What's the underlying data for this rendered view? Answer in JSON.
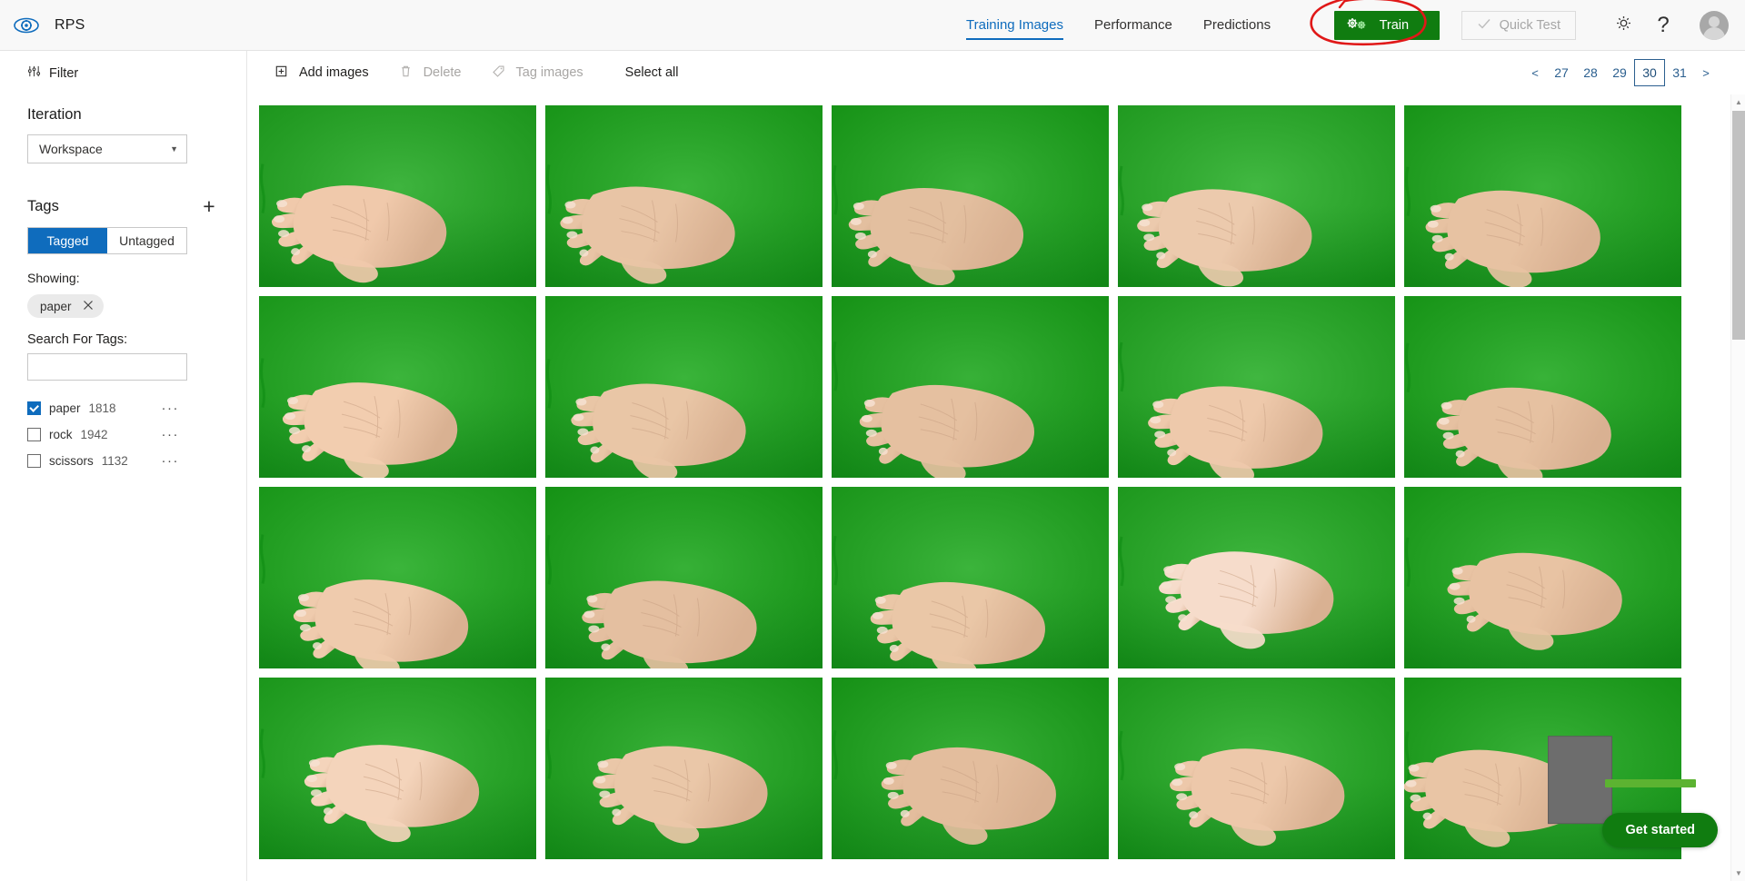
{
  "app": {
    "logo_icon": "eye-gear-icon",
    "title": "RPS"
  },
  "nav": {
    "tabs": [
      {
        "label": "Training Images",
        "active": true
      },
      {
        "label": "Performance",
        "active": false
      },
      {
        "label": "Predictions",
        "active": false
      }
    ]
  },
  "actions": {
    "train_label": "Train",
    "train_icon": "gears-icon",
    "train_color": "#107c10",
    "quick_test_label": "Quick Test",
    "quick_test_icon": "check-icon",
    "quick_test_enabled": false,
    "settings_icon": "gear-icon",
    "help_icon": "question-mark-icon",
    "avatar_icon": "user-avatar-icon"
  },
  "annotation": {
    "type": "hand-drawn-circle",
    "color": "#e01818",
    "target": "train-button"
  },
  "sidebar": {
    "filter": {
      "label": "Filter",
      "icon": "filter-sliders-icon"
    },
    "iteration": {
      "title": "Iteration",
      "selected": "Workspace",
      "caret_icon": "chevron-down-icon"
    },
    "tags": {
      "title": "Tags",
      "add_icon": "plus-icon",
      "toggle": [
        {
          "label": "Tagged",
          "active": true
        },
        {
          "label": "Untagged",
          "active": false
        }
      ],
      "showing_label": "Showing:",
      "showing_chips": [
        {
          "label": "paper",
          "remove_icon": "close-icon"
        }
      ],
      "search_label": "Search For Tags:",
      "search_value": "",
      "search_placeholder": "",
      "items": [
        {
          "name": "paper",
          "count": "1818",
          "checked": true,
          "menu_icon": "ellipsis-icon"
        },
        {
          "name": "rock",
          "count": "1942",
          "checked": false,
          "menu_icon": "ellipsis-icon"
        },
        {
          "name": "scissors",
          "count": "1132",
          "checked": false,
          "menu_icon": "ellipsis-icon"
        }
      ]
    }
  },
  "toolbar": {
    "add_images_label": "Add images",
    "add_images_icon": "add-image-icon",
    "delete_label": "Delete",
    "delete_icon": "trash-icon",
    "delete_enabled": false,
    "tag_images_label": "Tag images",
    "tag_images_icon": "tag-icon",
    "tag_images_enabled": false,
    "select_all_label": "Select all"
  },
  "pagination": {
    "prev_label": "<",
    "next_label": ">",
    "pages": [
      "27",
      "28",
      "29",
      "30",
      "31"
    ],
    "current": "30"
  },
  "gallery": {
    "columns": 5,
    "rows_visible": 4,
    "image_subject": "hand-open-palm-paper-gesture-on-green-background",
    "items": [
      {
        "id": 1,
        "tone": "#f0c9ab",
        "bg": "#1fa81f"
      },
      {
        "id": 2,
        "tone": "#e8c4a5",
        "bg": "#1aa71a"
      },
      {
        "id": 3,
        "tone": "#e3bf9f",
        "bg": "#18a518"
      },
      {
        "id": 4,
        "tone": "#eccaad",
        "bg": "#23ad23"
      },
      {
        "id": 5,
        "tone": "#e7c2a2",
        "bg": "#19a619"
      },
      {
        "id": 6,
        "tone": "#f2cdaf",
        "bg": "#1ca91c"
      },
      {
        "id": 7,
        "tone": "#e9c6a6",
        "bg": "#1aa81a"
      },
      {
        "id": 8,
        "tone": "#e5c0a0",
        "bg": "#17a417"
      },
      {
        "id": 9,
        "tone": "#eec9ab",
        "bg": "#21ab21"
      },
      {
        "id": 10,
        "tone": "#e6c1a1",
        "bg": "#18a618"
      },
      {
        "id": 11,
        "tone": "#efcbad",
        "bg": "#1ba91b"
      },
      {
        "id": 12,
        "tone": "#e4bfa0",
        "bg": "#16a416"
      },
      {
        "id": 13,
        "tone": "#eac7a7",
        "bg": "#1ca81c"
      },
      {
        "id": 14,
        "tone": "#f6dccb",
        "bg": "#20ab20"
      },
      {
        "id": 15,
        "tone": "#e8c3a3",
        "bg": "#19a719"
      },
      {
        "id": 16,
        "tone": "#f4d4bb",
        "bg": "#1da91d"
      },
      {
        "id": 17,
        "tone": "#eac7a8",
        "bg": "#1aa61a"
      },
      {
        "id": 18,
        "tone": "#e3bd9d",
        "bg": "#17a317"
      },
      {
        "id": 19,
        "tone": "#edc8aa",
        "bg": "#1faa1f"
      },
      {
        "id": 20,
        "tone": "#e9c5a5",
        "bg": "#18a518"
      }
    ]
  },
  "scrollbar": {
    "up_icon": "triangle-up-icon",
    "down_icon": "triangle-down-icon"
  },
  "overlay": {
    "progress_percent": 100,
    "progress_color": "#5cb331",
    "get_started_label": "Get started",
    "get_started_color": "#107c10"
  }
}
